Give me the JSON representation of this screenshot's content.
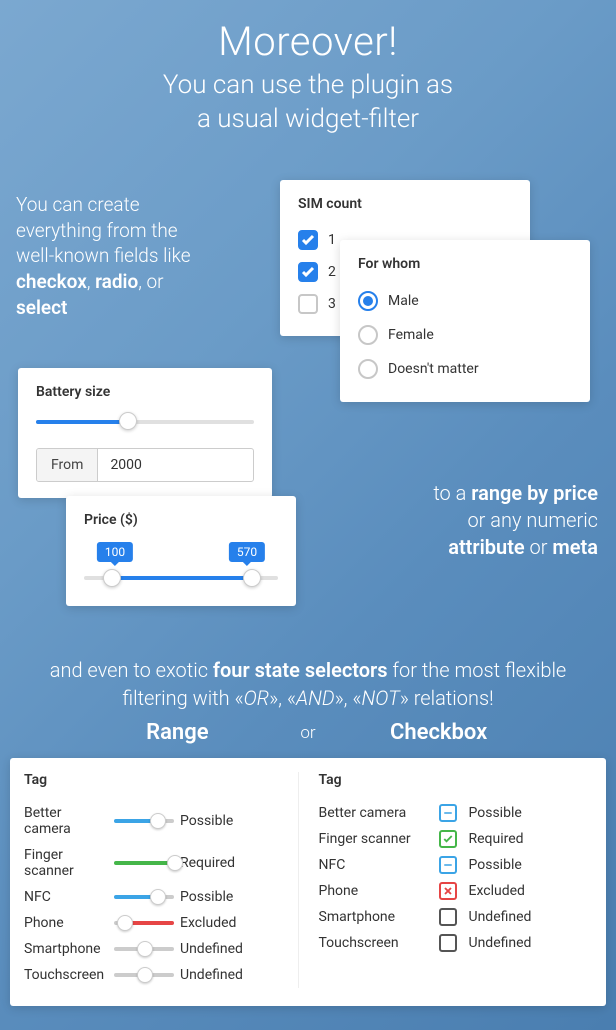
{
  "hero": {
    "title": "Moreover!",
    "subtitle_1": "You can use the plugin as",
    "subtitle_2": "a usual widget-filter"
  },
  "intro": {
    "l1": "You can create everything from the well-known fields like ",
    "b1": "checkox",
    "sep1": ", ",
    "b2": "radio",
    "sep2": ", or ",
    "b3": "select"
  },
  "sim": {
    "title": "SIM count",
    "items": [
      {
        "label": "1",
        "checked": true
      },
      {
        "label": "2",
        "checked": true
      },
      {
        "label": "3",
        "checked": false
      }
    ]
  },
  "whom": {
    "title": "For whom",
    "items": [
      {
        "label": "Male",
        "selected": true
      },
      {
        "label": "Female",
        "selected": false
      },
      {
        "label": "Doesn't matter",
        "selected": false
      }
    ]
  },
  "battery": {
    "title": "Battery size",
    "from_label": "From",
    "value": "2000"
  },
  "price": {
    "title": "Price ($)",
    "min": "100",
    "max": "570"
  },
  "right": {
    "l1a": "to a ",
    "l1b": "range by price",
    "l2": "or any numeric",
    "l3a": "attribute",
    "l3b": " or ",
    "l3c": "meta"
  },
  "exotic": {
    "p1": "and even to exotic ",
    "p2": "four state selectors",
    "p3": " for the most flexible filtering with «",
    "or": "OR",
    "s1": "», «",
    "and": "AND",
    "s2": "», «",
    "not": "NOT",
    "p4": "» relations!"
  },
  "roc": {
    "range": "Range",
    "or": "or",
    "checkbox": "Checkbox"
  },
  "tag_header": "Tag",
  "range_tags": [
    {
      "name": "Better camera",
      "state": "Possible",
      "color": "#3ba4e6",
      "pos": 60
    },
    {
      "name": "Finger scanner",
      "state": "Required",
      "color": "#45b649",
      "pos": 88
    },
    {
      "name": "NFC",
      "state": "Possible",
      "color": "#3ba4e6",
      "pos": 60
    },
    {
      "name": "Phone",
      "state": "Excluded",
      "color": "#e64545",
      "pos": 5
    },
    {
      "name": "Smartphone",
      "state": "Undefined",
      "color": "#ccc",
      "pos": 38
    },
    {
      "name": "Touchscreen",
      "state": "Undefined",
      "color": "#ccc",
      "pos": 38
    }
  ],
  "check_tags": [
    {
      "name": "Better camera",
      "state": "Possible",
      "color": "#3ba4e6",
      "icon": "minus"
    },
    {
      "name": "Finger scanner",
      "state": "Required",
      "color": "#45b649",
      "icon": "check"
    },
    {
      "name": "NFC",
      "state": "Possible",
      "color": "#3ba4e6",
      "icon": "minus"
    },
    {
      "name": "Phone",
      "state": "Excluded",
      "color": "#e64545",
      "icon": "x"
    },
    {
      "name": "Smartphone",
      "state": "Undefined",
      "color": "#555",
      "icon": "none"
    },
    {
      "name": "Touchscreen",
      "state": "Undefined",
      "color": "#555",
      "icon": "none"
    }
  ]
}
